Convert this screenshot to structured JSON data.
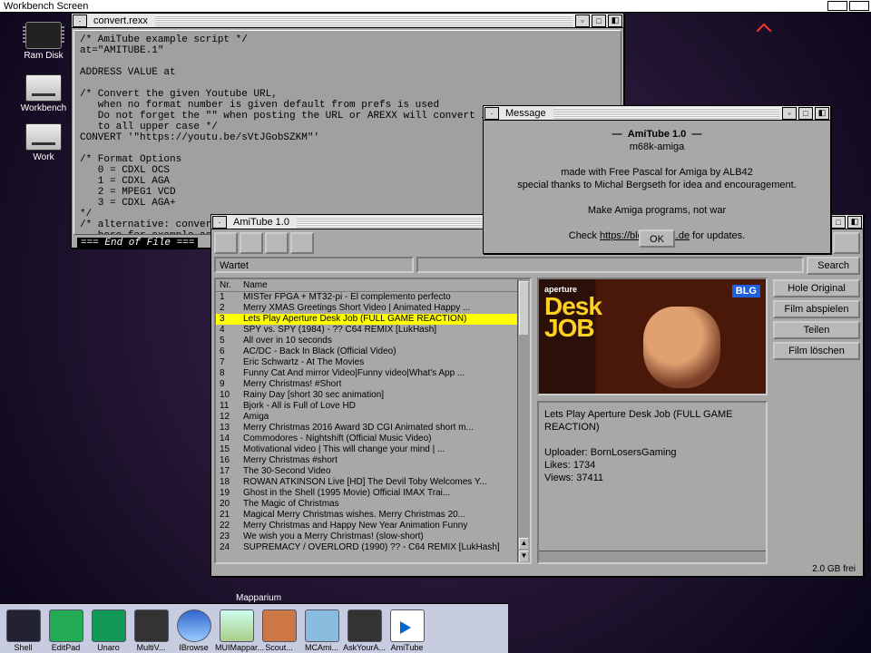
{
  "screenbar": {
    "title": "Workbench Screen"
  },
  "desktop_icons": {
    "ramdisk": "Ram Disk",
    "workbench": "Workbench",
    "work": "Work"
  },
  "editor": {
    "title": "convert.rexx",
    "code": "/* AmiTube example script */\nat=\"AMITUBE.1\"\n\nADDRESS VALUE at\n\n/* Convert the given Youtube URL,\n   when no format number is given default from prefs is used\n   Do not forget the \"\" when posting the URL or AREXX will convert it\n   to all upper case */\nCONVERT '\"https://youtu.be/sVtJGobSZKM\"'\n\n/* Format Options\n   0 = CDXL OCS\n   1 = CDXL AGA\n   2 = MPEG1 VCD\n   3 = CDXL AGA+\n*/\n/* alternative: convert and play after finished downloading,\n   here for example as MPEG\n   and with the 2nd valid URL schema  */\n\nPLAY '\"https://www.youtube.com/watch?v=sVtJGobSZKM\"' 2",
    "eof": "=== End of File ==="
  },
  "amitube": {
    "title": "AmiTube 1.0",
    "status": "Wartet",
    "search_btn": "Search",
    "cols": {
      "nr": "Nr.",
      "name": "Name"
    },
    "rows": [
      {
        "n": "1",
        "t": "MISTer FPGA + MT32-pi - El complemento perfecto"
      },
      {
        "n": "2",
        "t": "Merry XMAS Greetings Short Video | Animated Happy ..."
      },
      {
        "n": "3",
        "t": "Lets Play Aperture Desk Job (FULL GAME REACTION)"
      },
      {
        "n": "4",
        "t": "SPY vs. SPY (1984) - ?? C64 REMIX [LukHash]"
      },
      {
        "n": "5",
        "t": "All over in 10 seconds"
      },
      {
        "n": "6",
        "t": "AC/DC - Back In Black (Official Video)"
      },
      {
        "n": "7",
        "t": "Eric Schwartz - At The Movies"
      },
      {
        "n": "8",
        "t": "Funny Cat And mirror Video|Funny video|What's App ..."
      },
      {
        "n": "9",
        "t": "Merry Christmas! #Short"
      },
      {
        "n": "10",
        "t": "Rainy Day [short 30 sec animation]"
      },
      {
        "n": "11",
        "t": "Bjork - All is Full of Love HD"
      },
      {
        "n": "12",
        "t": "Amiga"
      },
      {
        "n": "13",
        "t": "Merry Christmas 2016 Award 3D CGI Animated short m..."
      },
      {
        "n": "14",
        "t": "Commodores - Nightshift (Official Music Video)"
      },
      {
        "n": "15",
        "t": "Motivational video | This will change your mind | ..."
      },
      {
        "n": "16",
        "t": "Merry Christmas #short"
      },
      {
        "n": "17",
        "t": "The 30-Second Video"
      },
      {
        "n": "18",
        "t": "ROWAN ATKINSON Live [HD] The Devil Toby Welcomes Y..."
      },
      {
        "n": "19",
        "t": "Ghost in the Shell (1995 Movie) Official IMAX Trai..."
      },
      {
        "n": "20",
        "t": "The Magic of Christmas"
      },
      {
        "n": "21",
        "t": "Magical Merry Christmas wishes. Merry Christmas 20..."
      },
      {
        "n": "22",
        "t": "Merry Christmas and Happy New Year Animation Funny"
      },
      {
        "n": "23",
        "t": "We wish you a Merry Christmas! (slow-short)"
      },
      {
        "n": "24",
        "t": "SUPREMACY / OVERLORD (1990) ?? - C64 REMIX [LukHash]"
      }
    ],
    "selected": 3,
    "thumb": {
      "brand": "aperture",
      "title1": "Desk",
      "title2": "JOB",
      "badge": "BLG"
    },
    "info": {
      "title": "Lets Play Aperture Desk Job (FULL GAME REACTION)",
      "uploader_label": "Uploader:",
      "uploader": "BornLosersGaming",
      "likes_label": "Likes:",
      "likes": "1734",
      "views_label": "Views:",
      "views": "37411"
    },
    "buttons": {
      "original": "Hole Original",
      "play": "Film abspielen",
      "share": "Teilen",
      "delete": "Film löschen"
    },
    "footer": "2.0 GB frei"
  },
  "message": {
    "title": "Message",
    "heading": "AmiTube 1.0",
    "platform": "m68k-amiga",
    "line1": "made with Free Pascal for Amiga by ALB42",
    "line2": "special thanks to Michal Bergseth for idea and encouragement.",
    "line3": "Make Amiga programs, not war",
    "line4a": "Check ",
    "line4b": "https://blog.alb42.de",
    "line4c": " for updates.",
    "ok": "OK"
  },
  "dock": {
    "hover": "Mapparium",
    "items": [
      "Shell",
      "EditPad",
      "Unaro",
      "MultiV...",
      "IBrowse",
      "MUIMappar...",
      "Scout...",
      "MCAmi...",
      "AskYourA...",
      "AmiTube"
    ]
  }
}
